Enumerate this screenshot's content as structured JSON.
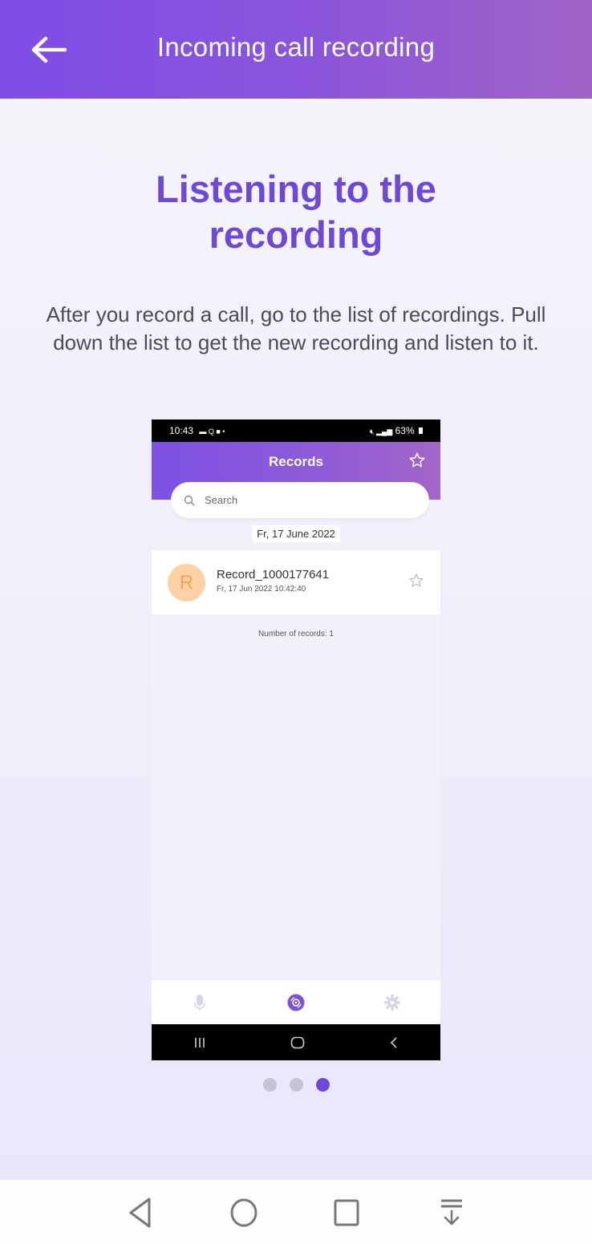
{
  "header": {
    "title": "Incoming call recording",
    "back_icon": "arrow-left-icon"
  },
  "onboarding": {
    "headline_line1": "Listening to the",
    "headline_line2": "recording",
    "description": "After you record a call, go to the list of recordings. Pull down the list to get the new recording and listen to it.",
    "page_count": 3,
    "active_page": 3,
    "accent_color": "#7048d8"
  },
  "phone_preview": {
    "status_bar": {
      "time": "10:43",
      "left_icons": "▬ Q ■ •",
      "battery": "63%"
    },
    "title": "Records",
    "search_placeholder": "Search",
    "date_group": "Fr, 17 June 2022",
    "records": [
      {
        "avatar_letter": "R",
        "name": "Record_1000177641",
        "datetime": "Fr, 17 Jun 2022 10:42:40"
      }
    ],
    "count_text": "Number of records: 1",
    "bottom_nav": [
      "microphone-icon",
      "records-disc-icon",
      "settings-gear-icon"
    ]
  },
  "system_nav": [
    "back-triangle-icon",
    "home-circle-icon",
    "recents-square-icon",
    "notification-pull-icon"
  ]
}
